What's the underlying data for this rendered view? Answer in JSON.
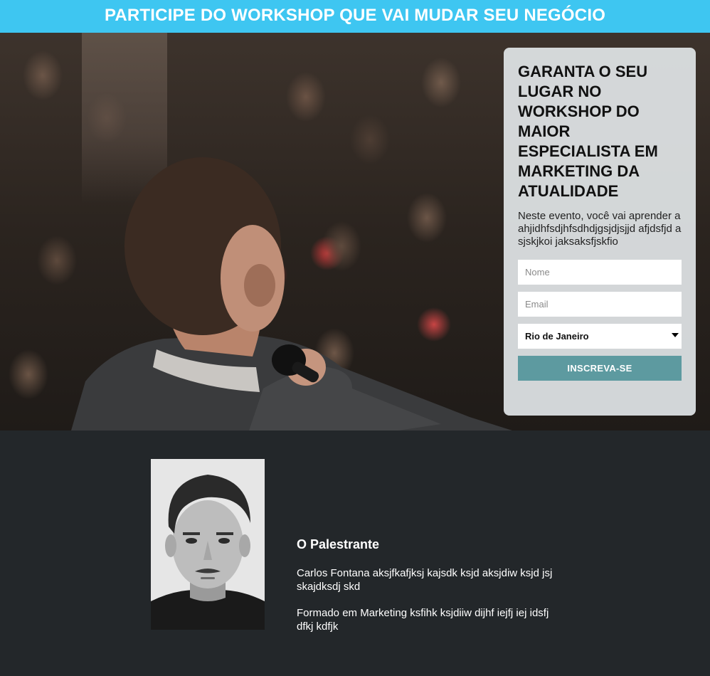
{
  "banner": {
    "title": "PARTICIPE DO WORKSHOP QUE VAI MUDAR SEU NEGÓCIO"
  },
  "form": {
    "heading": "GARANTA O SEU LUGAR NO WORKSHOP DO MAIOR ESPECIALISTA EM MARKETING DA ATUALIDADE",
    "description": "Neste evento, você vai aprender a ahjidhfsdjhfsdhdjgsjdjsjjd afjdsfjd asjskjkoi jaksaksfjskfio",
    "name_placeholder": "Nome",
    "email_placeholder": "Email",
    "city_selected": "Rio de Janeiro",
    "submit_label": "INSCREVA-SE"
  },
  "speaker": {
    "heading": "O Palestrante",
    "bio_1": "Carlos Fontana aksjfkafjksj kajsdk ksjd aksjdiw ksjd jsj skajdksdj skd",
    "bio_2": "Formado em Marketing ksfihk ksjdiiw dijhf iejfj iej idsfj dfkj kdfjk"
  },
  "colors": {
    "banner": "#3ec6f1",
    "submit": "#5d9aa0",
    "footer_bg": "#23272a"
  }
}
